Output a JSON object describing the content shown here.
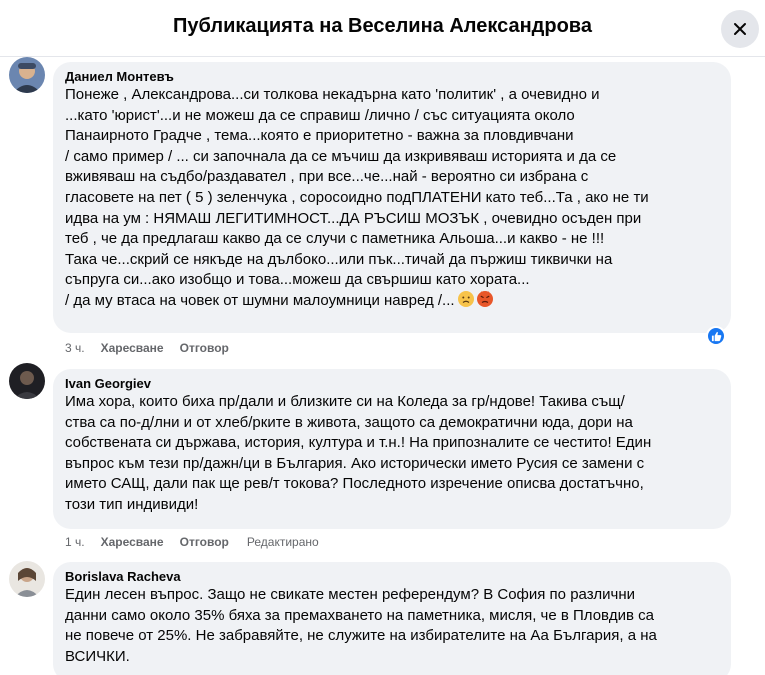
{
  "header": {
    "title": "Публикацията на Веселина Александрова",
    "close_icon": "close-icon"
  },
  "comments": [
    {
      "author": "Даниел Монтевъ",
      "text": "Понеже , Александрова...си толкова некадърна като 'политик' , а очевидно и\n...като 'юрист'...и не можеш да се справиш /лично / със ситуацията около\nПанаирното Градче , тема...която е приоритетно - важна за пловдивчани\n/ само пример / ... си започнала да се мъчиш да изкривяваш историята и да се\nвживяваш на съдбо/раздавател , при все...че...най - вероятно си избрана с\nгласовете на пет ( 5 ) зеленчука , соросоидно подПЛАТЕНИ като теб...Та , ако не ти\nидва на ум : НЯМАШ ЛЕГИТИМНОСТ...ДА РЪСИШ МОЗЪК , очевидно осъден при\nтеб , че да предлагаш какво да се случи с паметника Альоша...и какво - не !!!\nТака че...скрий се някъде на дълбоко...или пък...тичай да пържиш тиквички на\nсъпруга си...ако изобщо и това...можеш да свършиш като хората...\n/ да му втаса на човек от шумни малоумници навред /...",
      "emojis": [
        "sad-face-emoji",
        "angry-face-emoji"
      ],
      "time": "3 ч.",
      "like_label": "Харесване",
      "reply_label": "Отговор",
      "reaction_icon": "like-icon"
    },
    {
      "author": "Ivan Georgiev",
      "text": "Има хора, които биха пр/дали и близките си на Коледа за гр/ндове! Такива същ/\nства са по-д/лни и от хлеб/рките в живота, защото са демократични юда, дори на\nсобствената си държава, история, култура и т.н.! На припозналите се честито! Един\nвъпрос към тези пр/дажн/ци в България. Ако исторически името Русия се замени с\nимето САЩ, дали пак ще рев/т токова? Последното изречение описва достатъчно,\nтози тип индивиди!",
      "time": "1 ч.",
      "like_label": "Харесване",
      "reply_label": "Отговор",
      "edited_label": "Редактирано"
    },
    {
      "author": "Borislava Racheva",
      "text": "Един лесен въпрос. Защо не свикате местен референдум? В София по различни\nданни само около 35% бяха за премахването на паметника, мисля, че в Пловдив са\nне повече от 25%. Не забравяйте, не служите на избирателите на Аа България, а на\nВСИЧКИ."
    }
  ]
}
